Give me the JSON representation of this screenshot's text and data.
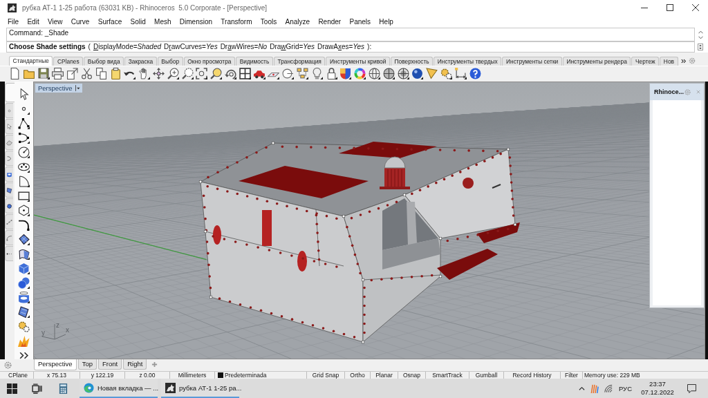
{
  "window": {
    "title": "рубка АТ-1 1-25 работа (63031 KB) - Rhinoceros  5.0 Corporate - [Perspective]"
  },
  "menu": [
    "File",
    "Edit",
    "View",
    "Curve",
    "Surface",
    "Solid",
    "Mesh",
    "Dimension",
    "Transform",
    "Tools",
    "Analyze",
    "Render",
    "Panels",
    "Help"
  ],
  "command": {
    "history": "Command: _Shade",
    "prompt": {
      "label": "Choose Shade settings",
      "open": "(",
      "options": [
        {
          "key": "D",
          "after": "isplayMode=",
          "value": "Shaded"
        },
        {
          "before": "D",
          "key": "r",
          "after": "awCurves=",
          "value": "Yes"
        },
        {
          "before": "Dr",
          "key": "a",
          "after": "wWires=",
          "value": "No"
        },
        {
          "before": "Dra",
          "key": "w",
          "after": "Grid=",
          "value": "Yes"
        },
        {
          "before": "DrawA",
          "key": "x",
          "after": "es=",
          "value": "Yes"
        }
      ],
      "close": "):"
    }
  },
  "toolbar_tabs": [
    {
      "label": "Стандартные",
      "selected": true
    },
    {
      "label": "CPlanes",
      "selected": false
    },
    {
      "label": "Выбор вида",
      "selected": false
    },
    {
      "label": "Закраска",
      "selected": false
    },
    {
      "label": "Выбор",
      "selected": false
    },
    {
      "label": "Окно просмотра",
      "selected": false
    },
    {
      "label": "Видимость",
      "selected": false
    },
    {
      "label": "Трансформация",
      "selected": false
    },
    {
      "label": "Инструменты кривой",
      "selected": false
    },
    {
      "label": "Поверхность",
      "selected": false
    },
    {
      "label": "Инструменты твердых",
      "selected": false
    },
    {
      "label": "Инструменты сетки",
      "selected": false
    },
    {
      "label": "Инструменты рендера",
      "selected": false
    },
    {
      "label": "Чертеж",
      "selected": false
    },
    {
      "label": "Нов",
      "selected": false
    }
  ],
  "sidebar_tabs": [
    {
      "selected": true
    },
    {
      "selected": false
    },
    {
      "selected": false
    },
    {
      "selected": false
    },
    {
      "selected": false
    },
    {
      "selected": false
    },
    {
      "selected": false
    },
    {
      "selected": false
    },
    {
      "selected": false
    },
    {
      "selected": false
    },
    {
      "selected": false
    }
  ],
  "viewport": {
    "title": "Perspective",
    "axis_labels": [
      "z",
      "y",
      "x"
    ]
  },
  "panel": {
    "title": "Rhinoce..."
  },
  "viewport_tabs": [
    {
      "label": "Perspective",
      "selected": true
    },
    {
      "label": "Top",
      "selected": false
    },
    {
      "label": "Front",
      "selected": false
    },
    {
      "label": "Right",
      "selected": false
    }
  ],
  "status_bar": [
    {
      "text": "CPlane",
      "kind": "label"
    },
    {
      "text": "x 75.13",
      "kind": "coord"
    },
    {
      "text": "y 122.19",
      "kind": "coord"
    },
    {
      "text": "z 0.00",
      "kind": "coord"
    },
    {
      "text": "Millimeters",
      "kind": "toggle"
    },
    {
      "text": "Predeterminada",
      "kind": "layer"
    },
    {
      "text": "Grid Snap",
      "kind": "toggle"
    },
    {
      "text": "Ortho",
      "kind": "toggle"
    },
    {
      "text": "Planar",
      "kind": "toggle"
    },
    {
      "text": "Osnap",
      "kind": "toggle"
    },
    {
      "text": "SmartTrack",
      "kind": "toggle"
    },
    {
      "text": "Gumball",
      "kind": "toggle"
    },
    {
      "text": "Record History",
      "kind": "toggle"
    },
    {
      "text": "Filter",
      "kind": "toggle"
    },
    {
      "text": "Memory use: 229 MB",
      "kind": "label"
    }
  ],
  "taskbar": {
    "apps": [
      {
        "label": "Новая вкладка — ...",
        "kind": "browser"
      },
      {
        "label": "рубка АТ-1 1-25 ра...",
        "kind": "cad"
      }
    ],
    "language": "РУС",
    "time": "23:37",
    "date": "07.12.2022"
  }
}
